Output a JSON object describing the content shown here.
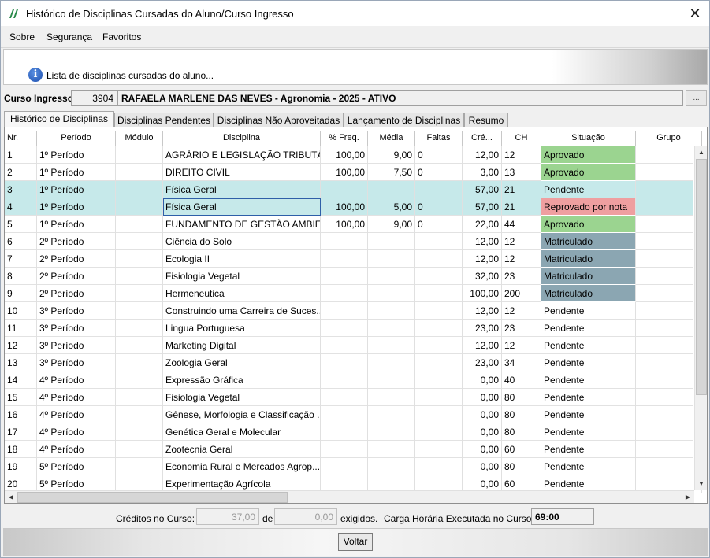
{
  "window": {
    "title": "Histórico de Disciplinas Cursadas do Aluno/Curso Ingresso",
    "close_glyph": "✕"
  },
  "menu": [
    "Sobre",
    "Segurança",
    "Favoritos"
  ],
  "info": {
    "icon": "info-icon",
    "text": "Lista de disciplinas cursadas do aluno..."
  },
  "curso": {
    "label": "Curso Ingresso:",
    "code": "3904",
    "name": "RAFAELA MARLENE DAS NEVES - Agronomia - 2025 - ATIVO",
    "button": "..."
  },
  "tabs": [
    "Histórico de Disciplinas",
    "Disciplinas Pendentes",
    "Disciplinas Não Aproveitadas",
    "Lançamento de Disciplinas",
    "Resumo"
  ],
  "columns": [
    "Nr.",
    "Período",
    "Módulo",
    "Disciplina",
    "% Freq.",
    "Média",
    "Faltas",
    "Cré...",
    "CH",
    "Situação",
    "Grupo"
  ],
  "rows": [
    {
      "nr": "1",
      "periodo": "1º Período",
      "modulo": "",
      "disciplina": "AGRÁRIO E LEGISLAÇÃO TRIBUTÁRIA",
      "freq": "100,00",
      "media": "9,00",
      "faltas": "0",
      "cred": "12,00",
      "ch": "12",
      "situacao": "Aprovado",
      "status": "aprovado"
    },
    {
      "nr": "2",
      "periodo": "1º Período",
      "modulo": "",
      "disciplina": "DIREITO CIVIL",
      "freq": "100,00",
      "media": "7,50",
      "faltas": "0",
      "cred": "3,00",
      "ch": "13",
      "situacao": "Aprovado",
      "status": "aprovado"
    },
    {
      "nr": "3",
      "periodo": "1º Período",
      "modulo": "",
      "disciplina": "Física Geral",
      "freq": "",
      "media": "",
      "faltas": "",
      "cred": "57,00",
      "ch": "21",
      "situacao": "Pendente",
      "status": "pendente",
      "highlight": true
    },
    {
      "nr": "4",
      "periodo": "1º Período",
      "modulo": "",
      "disciplina": "Física Geral",
      "freq": "100,00",
      "media": "5,00",
      "faltas": "0",
      "cred": "57,00",
      "ch": "21",
      "situacao": "Reprovado por nota",
      "status": "reprovado",
      "highlight": true,
      "focused": true
    },
    {
      "nr": "5",
      "periodo": "1º Período",
      "modulo": "",
      "disciplina": "FUNDAMENTO DE GESTÃO AMBIE...",
      "freq": "100,00",
      "media": "9,00",
      "faltas": "0",
      "cred": "22,00",
      "ch": "44",
      "situacao": "Aprovado",
      "status": "aprovado"
    },
    {
      "nr": "6",
      "periodo": "2º Período",
      "modulo": "",
      "disciplina": "Ciência do Solo",
      "freq": "",
      "media": "",
      "faltas": "",
      "cred": "12,00",
      "ch": "12",
      "situacao": "Matriculado",
      "status": "matriculado"
    },
    {
      "nr": "7",
      "periodo": "2º Período",
      "modulo": "",
      "disciplina": "Ecologia II",
      "freq": "",
      "media": "",
      "faltas": "",
      "cred": "12,00",
      "ch": "12",
      "situacao": "Matriculado",
      "status": "matriculado"
    },
    {
      "nr": "8",
      "periodo": "2º Período",
      "modulo": "",
      "disciplina": "Fisiologia Vegetal",
      "freq": "",
      "media": "",
      "faltas": "",
      "cred": "32,00",
      "ch": "23",
      "situacao": "Matriculado",
      "status": "matriculado"
    },
    {
      "nr": "9",
      "periodo": "2º Período",
      "modulo": "",
      "disciplina": "Hermeneutica",
      "freq": "",
      "media": "",
      "faltas": "",
      "cred": "100,00",
      "ch": "200",
      "situacao": "Matriculado",
      "status": "matriculado"
    },
    {
      "nr": "10",
      "periodo": "3º Período",
      "modulo": "",
      "disciplina": "Construindo uma Carreira de Suces...",
      "freq": "",
      "media": "",
      "faltas": "",
      "cred": "12,00",
      "ch": "12",
      "situacao": "Pendente",
      "status": "pendente"
    },
    {
      "nr": "11",
      "periodo": "3º Período",
      "modulo": "",
      "disciplina": "Lingua Portuguesa",
      "freq": "",
      "media": "",
      "faltas": "",
      "cred": "23,00",
      "ch": "23",
      "situacao": "Pendente",
      "status": "pendente"
    },
    {
      "nr": "12",
      "periodo": "3º Período",
      "modulo": "",
      "disciplina": "Marketing Digital",
      "freq": "",
      "media": "",
      "faltas": "",
      "cred": "12,00",
      "ch": "12",
      "situacao": "Pendente",
      "status": "pendente"
    },
    {
      "nr": "13",
      "periodo": "3º Período",
      "modulo": "",
      "disciplina": "Zoologia Geral",
      "freq": "",
      "media": "",
      "faltas": "",
      "cred": "23,00",
      "ch": "34",
      "situacao": "Pendente",
      "status": "pendente"
    },
    {
      "nr": "14",
      "periodo": "4º Período",
      "modulo": "",
      "disciplina": "Expressão Gráfica",
      "freq": "",
      "media": "",
      "faltas": "",
      "cred": "0,00",
      "ch": "40",
      "situacao": "Pendente",
      "status": "pendente"
    },
    {
      "nr": "15",
      "periodo": "4º Período",
      "modulo": "",
      "disciplina": "Fisiologia Vegetal",
      "freq": "",
      "media": "",
      "faltas": "",
      "cred": "0,00",
      "ch": "80",
      "situacao": "Pendente",
      "status": "pendente"
    },
    {
      "nr": "16",
      "periodo": "4º Período",
      "modulo": "",
      "disciplina": "Gênese, Morfologia e Classificação ...",
      "freq": "",
      "media": "",
      "faltas": "",
      "cred": "0,00",
      "ch": "80",
      "situacao": "Pendente",
      "status": "pendente"
    },
    {
      "nr": "17",
      "periodo": "4º Período",
      "modulo": "",
      "disciplina": "Genética Geral e Molecular",
      "freq": "",
      "media": "",
      "faltas": "",
      "cred": "0,00",
      "ch": "80",
      "situacao": "Pendente",
      "status": "pendente"
    },
    {
      "nr": "18",
      "periodo": "4º Período",
      "modulo": "",
      "disciplina": "Zootecnia Geral",
      "freq": "",
      "media": "",
      "faltas": "",
      "cred": "0,00",
      "ch": "60",
      "situacao": "Pendente",
      "status": "pendente"
    },
    {
      "nr": "19",
      "periodo": "5º Período",
      "modulo": "",
      "disciplina": "Economia Rural e Mercados Agrop...",
      "freq": "",
      "media": "",
      "faltas": "",
      "cred": "0,00",
      "ch": "80",
      "situacao": "Pendente",
      "status": "pendente"
    },
    {
      "nr": "20",
      "periodo": "5º Período",
      "modulo": "",
      "disciplina": "Experimentação Agrícola",
      "freq": "",
      "media": "",
      "faltas": "",
      "cred": "0,00",
      "ch": "60",
      "situacao": "Pendente",
      "status": "pendente"
    }
  ],
  "footer": {
    "creditos_label": "Créditos no Curso:",
    "creditos_value": "37,00",
    "de_label": "de",
    "exigidos_value": "0,00",
    "exigidos_label": "exigidos.",
    "carga_label": "Carga Horária Executada no Curso:",
    "carga_value": "69:00"
  },
  "buttons": {
    "voltar": "Voltar"
  },
  "colors": {
    "aprovado": "#9bd490",
    "reprovado": "#ef9fa0",
    "matriculado": "#8ba6b2",
    "highlight_row": "#c6e9ea"
  }
}
